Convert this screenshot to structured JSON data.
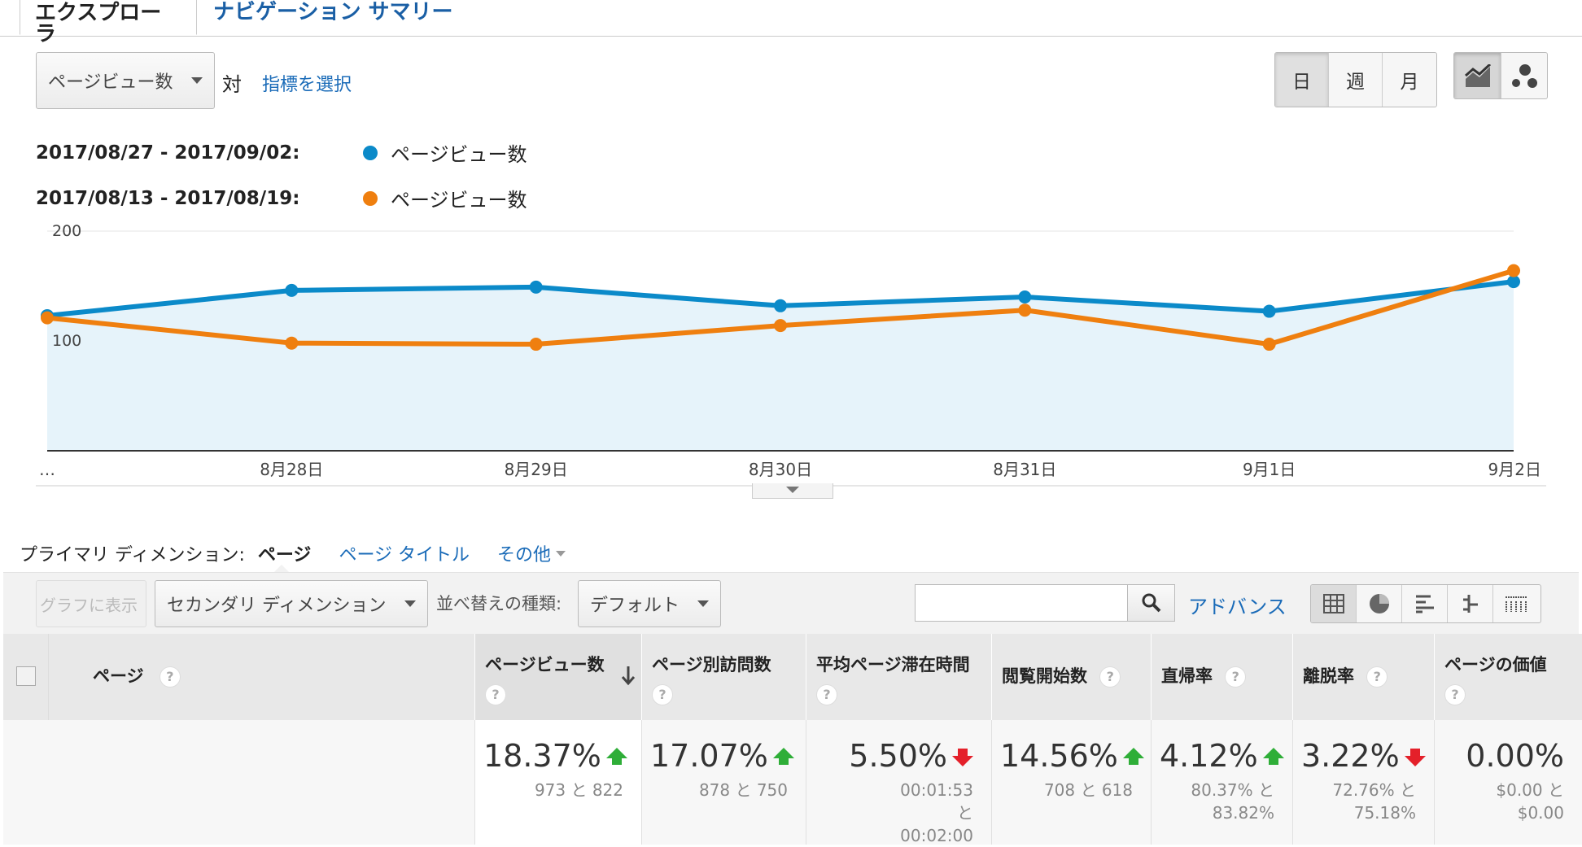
{
  "tabs": [
    {
      "label": "エクスプローラ"
    },
    {
      "label": "ナビゲーション サマリー"
    }
  ],
  "metric_select": {
    "value": "ページビュー数",
    "vs_label": "対",
    "choose_metric": "指標を選択"
  },
  "period_buttons": [
    "日",
    "週",
    "月"
  ],
  "chart_type_buttons": [
    {
      "icon": "line-chart-icon"
    },
    {
      "icon": "motion-chart-icon"
    }
  ],
  "legend": [
    {
      "range": "2017/08/27 - 2017/09/02:",
      "metric": "ページビュー数",
      "color": "#0b8ac9"
    },
    {
      "range": "2017/08/13 - 2017/08/19:",
      "metric": "ページビュー数",
      "color": "#ef7f0f"
    }
  ],
  "chart_data": {
    "type": "line",
    "x": [
      "…",
      "8月28日",
      "8月29日",
      "8月30日",
      "8月31日",
      "9月1日",
      "9月2日"
    ],
    "y_ticks": [
      "200",
      "100"
    ],
    "ylim": [
      0,
      200
    ],
    "series": [
      {
        "values": [
          123,
          146,
          149,
          132,
          140,
          127,
          154
        ],
        "color": "#0b8ac9"
      },
      {
        "values": [
          121,
          98,
          97,
          114,
          128,
          97,
          164
        ],
        "color": "#ef7f0f"
      }
    ]
  },
  "dimension": {
    "label": "プライマリ ディメンション:",
    "active": "ページ",
    "options": [
      "ページ タイトル",
      "その他"
    ]
  },
  "toolbar": {
    "plot_button": "グラフに表示",
    "secondary_dimension": "セカンダリ ディメンション",
    "sort_label": "並べ替えの種類:",
    "sort_value": "デフォルト",
    "search_placeholder": "",
    "advanced": "アドバンス",
    "view_icons": [
      "table-view-icon",
      "pie-view-icon",
      "performance-view-icon",
      "comparison-view-icon",
      "pivot-view-icon"
    ]
  },
  "table": {
    "columns": [
      "ページ",
      "ページビュー数",
      "ページ別訪問数",
      "平均ページ滞在時間",
      "閲覧開始数",
      "直帰率",
      "離脱率",
      "ページの価値"
    ],
    "summary": [
      {
        "pct": "18.37%",
        "trend": "up",
        "sub": "973 と 822"
      },
      {
        "pct": "17.07%",
        "trend": "up",
        "sub": "878 と 750"
      },
      {
        "pct": "5.50%",
        "trend": "down",
        "sub": "00:01:53 と 00:02:00"
      },
      {
        "pct": "14.56%",
        "trend": "up",
        "sub": "708 と 618"
      },
      {
        "pct": "4.12%",
        "trend": "up",
        "sub": "80.37% と 83.82%"
      },
      {
        "pct": "3.22%",
        "trend": "down",
        "sub": "72.76% と 75.18%"
      },
      {
        "pct": "0.00%",
        "trend": "none",
        "sub": "$0.00 と $0.00"
      }
    ]
  }
}
